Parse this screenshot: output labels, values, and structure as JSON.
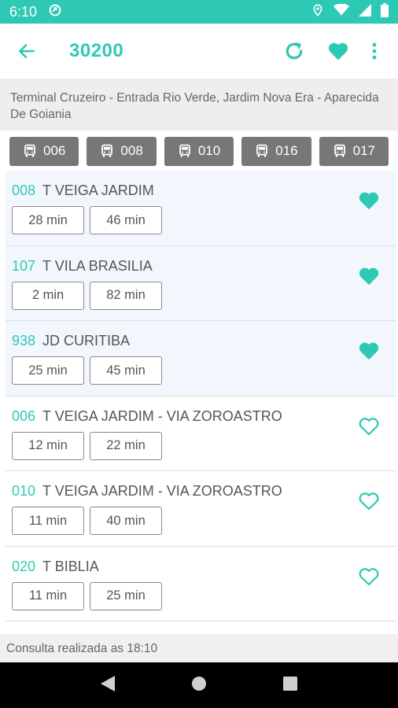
{
  "status_bar": {
    "time": "6:10",
    "background": "#2ec9b4"
  },
  "app_bar": {
    "title": "30200",
    "accent": "#2ec9b4"
  },
  "address": "Terminal Cruzeiro - Entrada Rio Verde, Jardim Nova Era - Aparecida De Goiania",
  "stops": [
    "006",
    "008",
    "010",
    "016",
    "017"
  ],
  "routes": [
    {
      "number": "008",
      "name": "T VEIGA JARDIM",
      "times": [
        "28 min",
        "46 min"
      ],
      "favorite": true
    },
    {
      "number": "107",
      "name": "T VILA BRASILIA",
      "times": [
        "2 min",
        "82 min"
      ],
      "favorite": true
    },
    {
      "number": "938",
      "name": "JD CURITIBA",
      "times": [
        "25 min",
        "45 min"
      ],
      "favorite": true
    },
    {
      "number": "006",
      "name": "T VEIGA JARDIM - VIA ZOROASTRO",
      "times": [
        "12 min",
        "22 min"
      ],
      "favorite": false
    },
    {
      "number": "010",
      "name": "T VEIGA JARDIM - VIA ZOROASTRO",
      "times": [
        "11 min",
        "40 min"
      ],
      "favorite": false
    },
    {
      "number": "020",
      "name": "T BIBLIA",
      "times": [
        "11 min",
        "25 min"
      ],
      "favorite": false
    }
  ],
  "footer": "Consulta realizada as 18:10",
  "icons": {
    "back": "arrow-left-icon",
    "refresh": "refresh-icon",
    "favorites": "heart-icon",
    "more": "more-vert-icon",
    "bus": "bus-icon"
  }
}
